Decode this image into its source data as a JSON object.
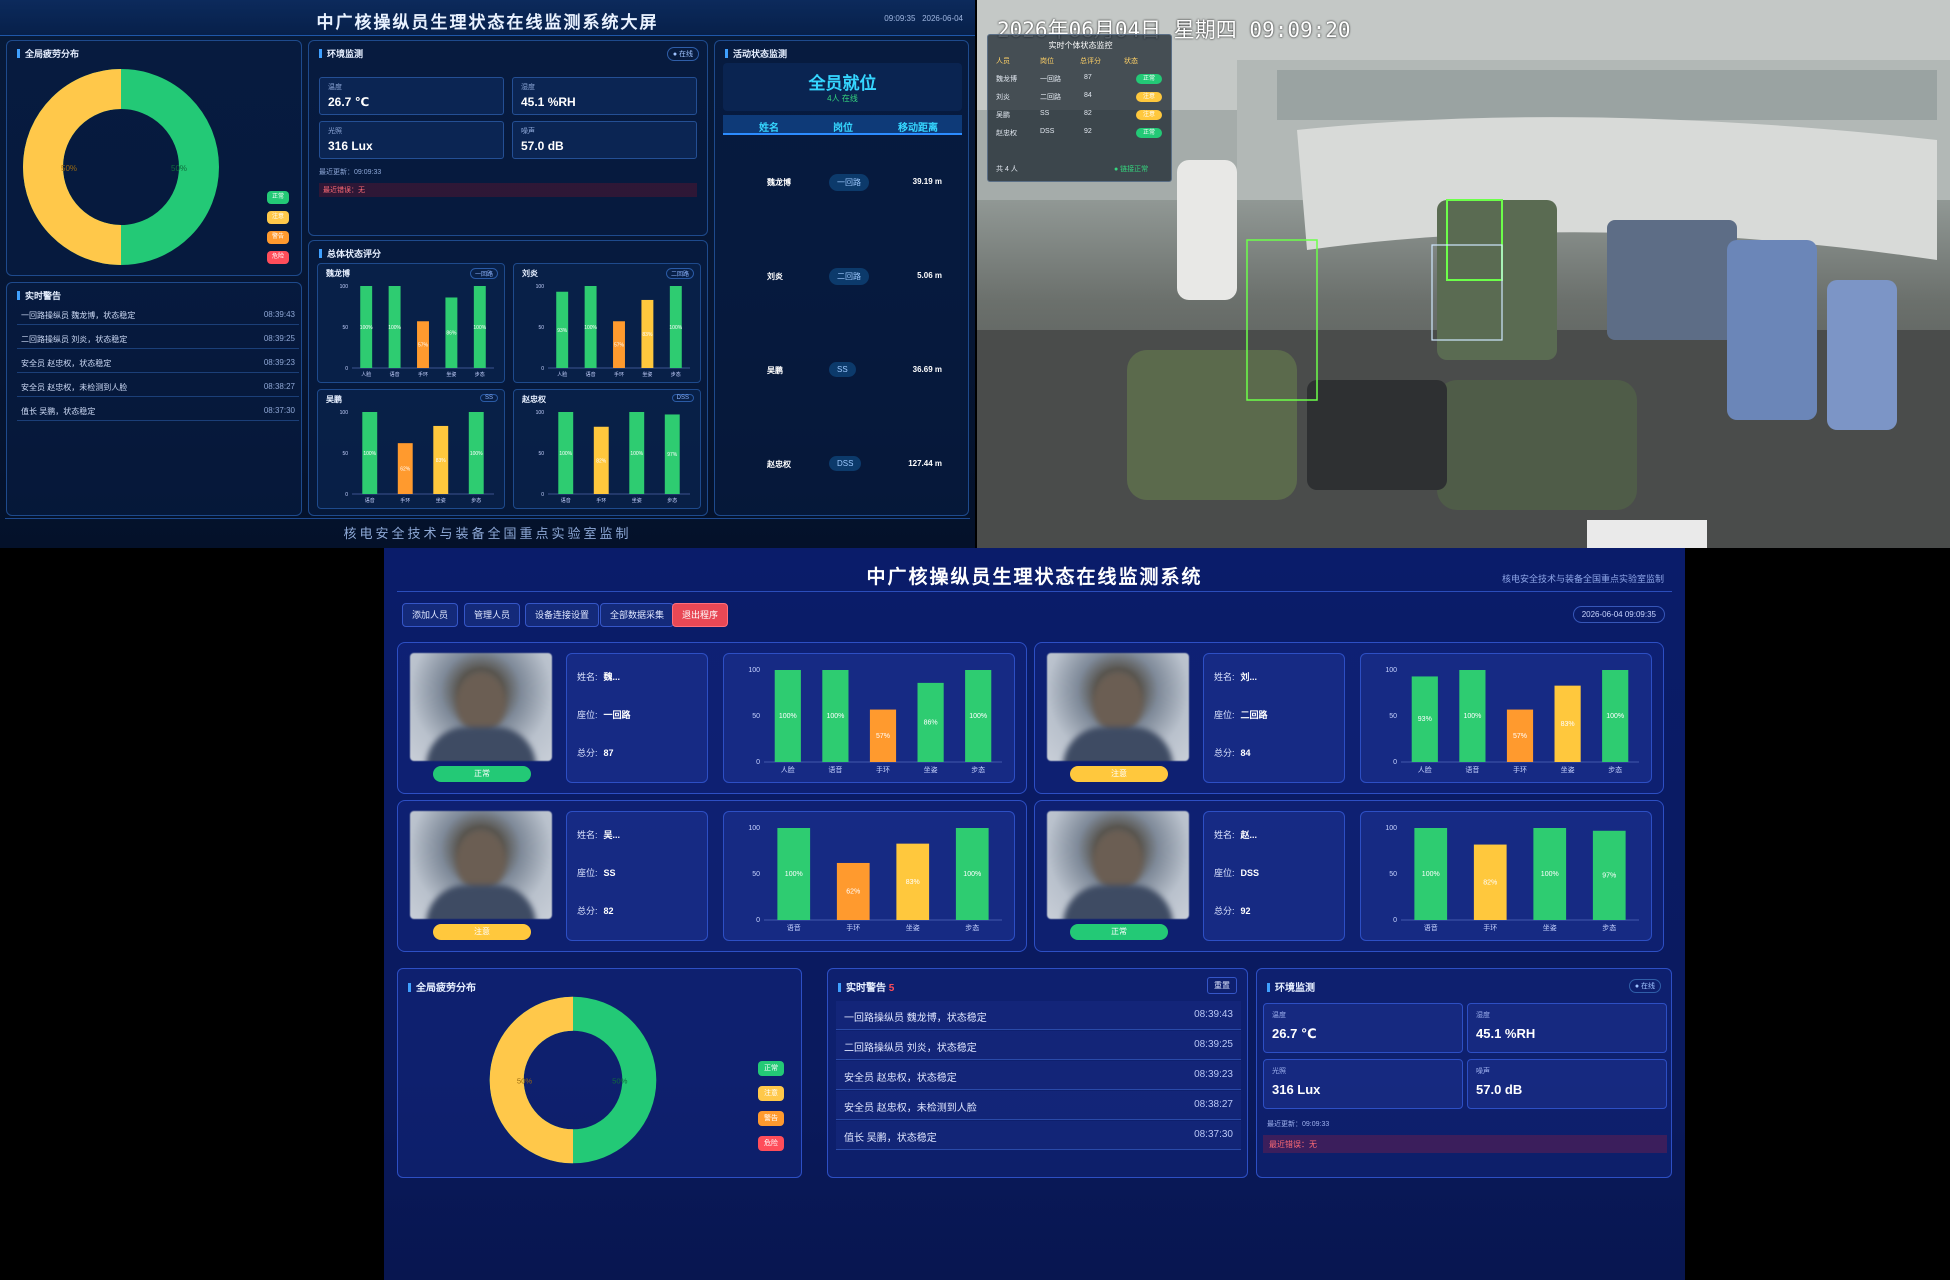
{
  "top": {
    "title": "中广核操纵员生理状态在线监测系统大屏",
    "time": "09:09:35",
    "date": "2026-06-04",
    "footer": "核电安全技术与装备全国重点实验室监制",
    "fatigue": {
      "title": "全局疲劳分布",
      "left_label": "50%",
      "right_label": "50%",
      "legend": [
        "正常",
        "注意",
        "警告",
        "危险"
      ]
    },
    "env": {
      "title": "环境监测",
      "status": "● 在线",
      "items": [
        {
          "label": "温度",
          "value": "26.7 ℃"
        },
        {
          "label": "湿度",
          "value": "45.1 %RH"
        },
        {
          "label": "光照",
          "value": "316 Lux"
        },
        {
          "label": "噪声",
          "value": "57.0 dB"
        }
      ],
      "updated": "最近更新：09:09:33",
      "error": "最近错误：无"
    },
    "alerts": {
      "title": "实时警告",
      "rows": [
        {
          "msg": "一回路操纵员 魏龙博，状态稳定",
          "time": "08:39:43"
        },
        {
          "msg": "二回路操纵员 刘炎，状态稳定",
          "time": "08:39:25"
        },
        {
          "msg": "安全员 赵忠权，状态稳定",
          "time": "08:39:23"
        },
        {
          "msg": "安全员 赵忠权，未检测到人脸",
          "time": "08:38:27"
        },
        {
          "msg": "值长 吴鹏，状态稳定",
          "time": "08:37:30"
        }
      ]
    },
    "overall": {
      "title": "总体状态评分",
      "people": [
        {
          "name": "魏龙博",
          "seat": "一回路"
        },
        {
          "name": "刘炎",
          "seat": "二回路"
        },
        {
          "name": "吴鹏",
          "seat": "SS"
        },
        {
          "name": "赵忠权",
          "seat": "DSS"
        }
      ]
    },
    "activity": {
      "title": "活动状态监测",
      "headline": "全员就位",
      "sub": "4人 在线",
      "headers": [
        "姓名",
        "岗位",
        "移动距离"
      ],
      "rows": [
        {
          "name": "魏龙博",
          "pos": "一回路",
          "dist": "39.19 m"
        },
        {
          "name": "刘炎",
          "pos": "二回路",
          "dist": "5.06 m"
        },
        {
          "name": "吴鹏",
          "pos": "SS",
          "dist": "36.69 m"
        },
        {
          "name": "赵忠权",
          "pos": "DSS",
          "dist": "127.44 m"
        }
      ]
    }
  },
  "camera": {
    "timestamp": "2026年06月04日  星期四  09:09:20",
    "overlay_title": "实时个体状态监控",
    "overlay_headers": [
      "人员",
      "岗位",
      "总评分",
      "状态"
    ],
    "overlay_rows": [
      {
        "name": "魏龙博",
        "seat": "一回路",
        "score": "87",
        "status": "正常"
      },
      {
        "name": "刘炎",
        "seat": "二回路",
        "score": "84",
        "status": "注意"
      },
      {
        "name": "吴鹏",
        "seat": "SS",
        "score": "82",
        "status": "注意"
      },
      {
        "name": "赵忠权",
        "seat": "DSS",
        "score": "92",
        "status": "正常"
      }
    ],
    "overlay_footer_left": "共 4 人",
    "overlay_footer_right": "● 链接正常"
  },
  "bottom": {
    "title": "中广核操纵员生理状态在线监测系统",
    "subtitle": "核电安全技术与装备全国重点实验室监制",
    "toolbar": [
      "添加人员",
      "管理人员",
      "设备连接设置",
      "全部数据采集",
      "退出程序"
    ],
    "datetime": "2026-06-04 09:09:35",
    "labels": {
      "name": "姓名:",
      "seat": "座位:",
      "score": "总分:"
    },
    "cards": [
      {
        "name": "魏...",
        "seat": "一回路",
        "score": "87",
        "status": "正常"
      },
      {
        "name": "刘...",
        "seat": "二回路",
        "score": "84",
        "status": "注意"
      },
      {
        "name": "吴...",
        "seat": "SS",
        "score": "82",
        "status": "注意"
      },
      {
        "name": "赵...",
        "seat": "DSS",
        "score": "92",
        "status": "正常"
      }
    ],
    "fatigue": {
      "title": "全局疲劳分布",
      "left_label": "50%",
      "right_label": "50%",
      "legend": [
        "正常",
        "注意",
        "警告",
        "危险"
      ]
    },
    "alerts": {
      "title": "实时警告",
      "count": "5",
      "reset": "重置",
      "rows": [
        {
          "msg": "一回路操纵员 魏龙博，状态稳定",
          "time": "08:39:43"
        },
        {
          "msg": "二回路操纵员 刘炎，状态稳定",
          "time": "08:39:25"
        },
        {
          "msg": "安全员 赵忠权，状态稳定",
          "time": "08:39:23"
        },
        {
          "msg": "安全员 赵忠权，未检测到人脸",
          "time": "08:38:27"
        },
        {
          "msg": "值长 吴鹏，状态稳定",
          "time": "08:37:30"
        }
      ]
    },
    "env": {
      "title": "环境监测",
      "status": "● 在线",
      "items": [
        {
          "label": "温度",
          "value": "26.7 ℃"
        },
        {
          "label": "湿度",
          "value": "45.1 %RH"
        },
        {
          "label": "光照",
          "value": "316 Lux"
        },
        {
          "label": "噪声",
          "value": "57.0 dB"
        }
      ],
      "updated": "最近更新：09:09:33",
      "error": "最近错误：无"
    }
  },
  "colors": {
    "green": "#2ecc71",
    "orange": "#ff9a2e",
    "yellow": "#ffc83d",
    "red": "#ff4d5a",
    "donut_yellow": "#ffc84a",
    "donut_green": "#23c976"
  },
  "chart_data": [
    {
      "type": "bar",
      "title": "魏龙博",
      "categories": [
        "人脸",
        "语音",
        "手环",
        "坐姿",
        "步态"
      ],
      "values": [
        100,
        100,
        57,
        86,
        100
      ],
      "ylim": [
        0,
        100
      ],
      "colors": [
        "green",
        "green",
        "orange",
        "green",
        "green"
      ]
    },
    {
      "type": "bar",
      "title": "刘炎",
      "categories": [
        "人脸",
        "语音",
        "手环",
        "坐姿",
        "步态"
      ],
      "values": [
        93,
        100,
        57,
        83,
        100
      ],
      "ylim": [
        0,
        100
      ],
      "colors": [
        "green",
        "green",
        "orange",
        "yellow",
        "green"
      ]
    },
    {
      "type": "bar",
      "title": "吴鹏",
      "categories": [
        "语音",
        "手环",
        "坐姿",
        "步态"
      ],
      "values": [
        100,
        62,
        83,
        100
      ],
      "ylim": [
        0,
        100
      ],
      "colors": [
        "green",
        "orange",
        "yellow",
        "green"
      ]
    },
    {
      "type": "bar",
      "title": "赵忠权",
      "categories": [
        "语音",
        "手环",
        "坐姿",
        "步态"
      ],
      "values": [
        100,
        82,
        100,
        97
      ],
      "ylim": [
        0,
        100
      ],
      "colors": [
        "green",
        "yellow",
        "green",
        "green"
      ]
    },
    {
      "type": "pie",
      "title": "全局疲劳分布",
      "categories": [
        "正常",
        "注意"
      ],
      "values": [
        50,
        50
      ]
    }
  ]
}
